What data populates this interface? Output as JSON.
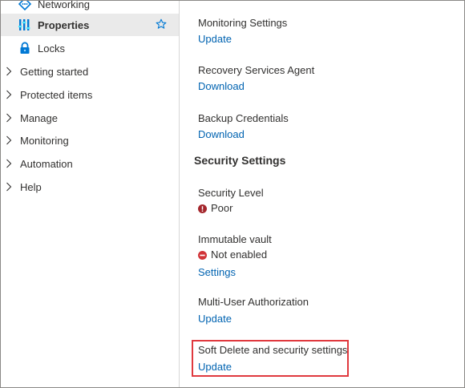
{
  "sidebar": {
    "items": [
      {
        "label": "Networking",
        "icon": "networking-icon"
      },
      {
        "label": "Properties",
        "icon": "properties-icon",
        "selected": true
      },
      {
        "label": "Locks",
        "icon": "lock-icon"
      },
      {
        "label": "Getting started"
      },
      {
        "label": "Protected items"
      },
      {
        "label": "Manage"
      },
      {
        "label": "Monitoring"
      },
      {
        "label": "Automation"
      },
      {
        "label": "Help"
      }
    ]
  },
  "main": {
    "monitoring_settings": {
      "title": "Monitoring Settings",
      "link": "Update"
    },
    "recovery_agent": {
      "title": "Recovery Services Agent",
      "link": "Download"
    },
    "backup_credentials": {
      "title": "Backup Credentials",
      "link": "Download"
    },
    "security_section_title": "Security Settings",
    "security_level": {
      "title": "Security Level",
      "status": "Poor",
      "status_icon": "warning-icon"
    },
    "immutable_vault": {
      "title": "Immutable vault",
      "status": "Not enabled",
      "status_icon": "blocked-icon",
      "link": "Settings"
    },
    "mua": {
      "title": "Multi-User Authorization",
      "link": "Update"
    },
    "soft_delete": {
      "title": "Soft Delete and security settings",
      "link": "Update"
    }
  },
  "colors": {
    "link": "#0063b1",
    "selected_bg": "#eaeaea",
    "highlight_border": "#e0393e",
    "error_red": "#a4262c"
  }
}
